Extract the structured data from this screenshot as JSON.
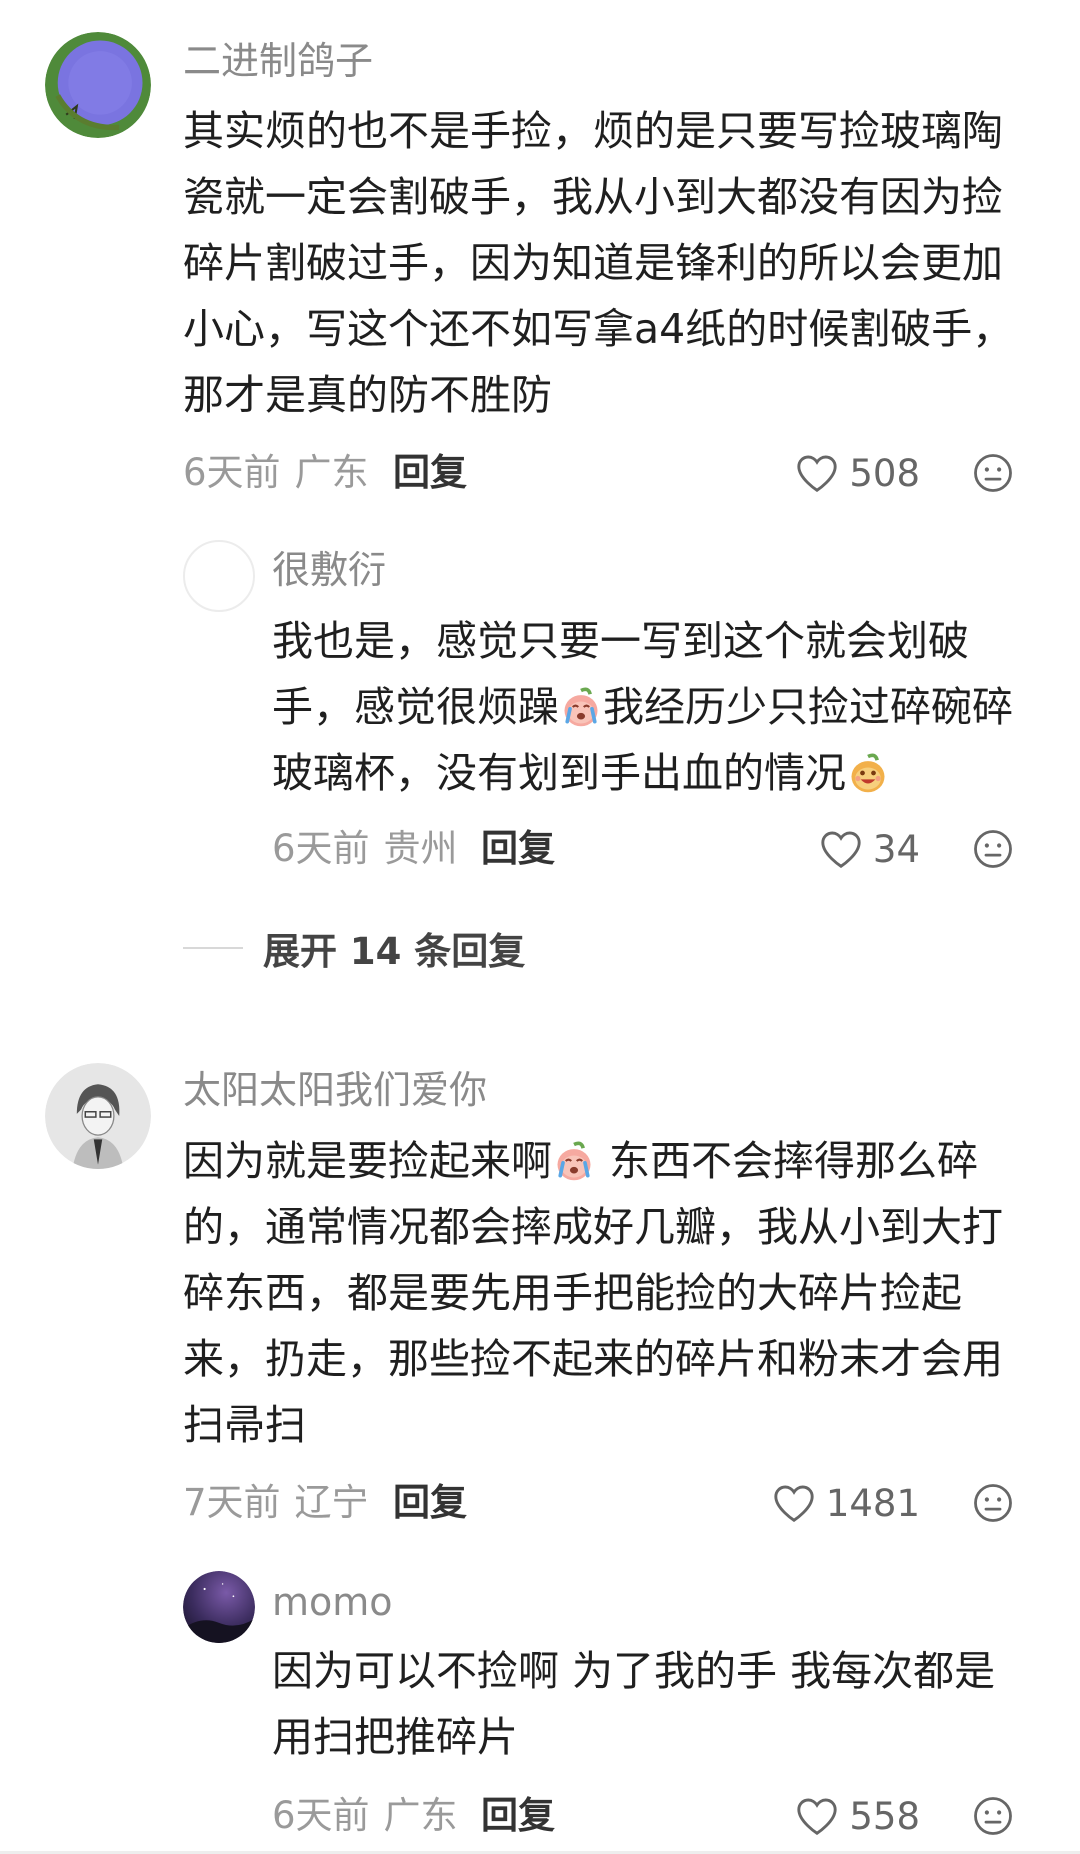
{
  "comments": [
    {
      "username": "二进制鸽子",
      "text_lines": [
        "其实烦的也不是手捡，烦的是只要写捡玻璃陶",
        "瓷就一定会割破手，我从小到大都没有因为捡",
        "碎片割破过手，因为知道是锋利的所以会更加",
        "小心，写这个还不如写拿a4纸的时候割破手，",
        "那才是真的防不胜防"
      ],
      "time": "6天前",
      "location": "广东",
      "reply_label": "回复",
      "likes": "508",
      "replies": [
        {
          "username": "很敷衍",
          "text_lines": [
            "我也是，感觉只要一写到这个就会划破",
            "手，感觉很烦躁",
            "我经历少只捡过碎碗碎",
            "玻璃杯，没有划到手出血的情况"
          ],
          "time": "6天前",
          "location": "贵州",
          "reply_label": "回复",
          "likes": "34"
        }
      ],
      "expand_label": "展开 14 条回复"
    },
    {
      "username": "太阳太阳我们爱你",
      "text_lines": [
        "因为就是要捡起来啊",
        " 东西不会摔得那么碎",
        "的，通常情况都会摔成好几瓣，我从小到大打",
        "碎东西，都是要先用手把能捡的大碎片捡起",
        "来，扔走，那些捡不起来的碎片和粉末才会用",
        "扫帚扫"
      ],
      "time": "7天前",
      "location": "辽宁",
      "reply_label": "回复",
      "likes": "1481",
      "replies": [
        {
          "username": "momo",
          "text_lines": [
            "因为可以不捡啊 为了我的手 我每次都是",
            "用扫把推碎片"
          ],
          "time": "6天前",
          "location": "广东",
          "reply_label": "回复",
          "likes": "558"
        }
      ]
    }
  ],
  "icons": {
    "like": "heart-outline-icon",
    "more": "neutral-face-icon",
    "emoji_crying": "crying-peach-emoji",
    "emoji_happy": "grinning-peach-emoji"
  },
  "colors": {
    "username": "#8a8a8a",
    "body": "#1f1f1f",
    "meta": "#9a9a9a",
    "reply_button": "#333333"
  }
}
